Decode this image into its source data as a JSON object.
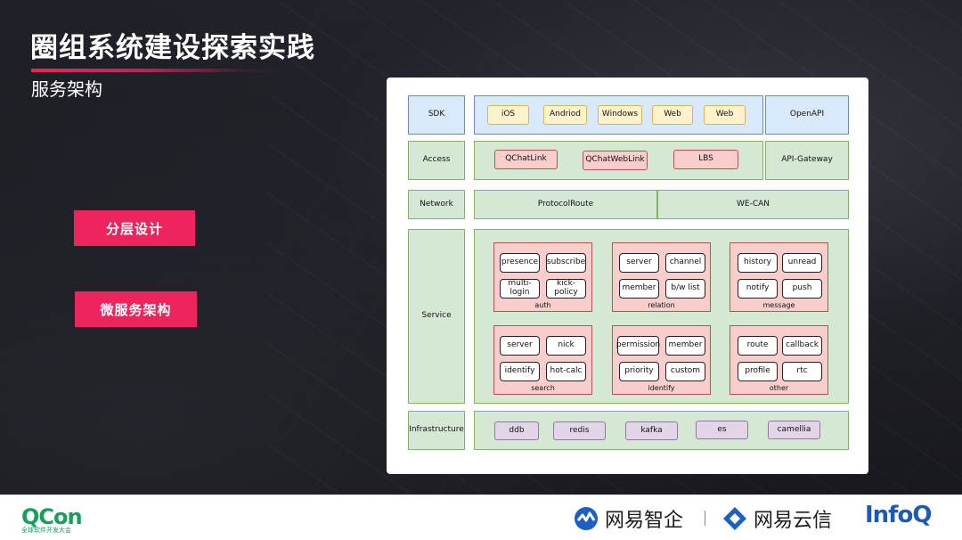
{
  "slide": {
    "title": "圈组系统建设探索实践",
    "subtitle": "服务架构",
    "pills": [
      "分层设计",
      "微服务架构"
    ]
  },
  "diagram": {
    "layers": [
      {
        "label": "SDK",
        "items": [
          "iOS",
          "Andriod",
          "Windows",
          "Web",
          "Web"
        ],
        "side": "OpenAPI"
      },
      {
        "label": "Access",
        "items": [
          "QChatLink",
          "QChatWebLink",
          "LBS"
        ],
        "side": "API-Gateway"
      },
      {
        "label": "Network",
        "items": [
          "ProtocolRoute",
          "WE-CAN"
        ]
      },
      {
        "label": "Service"
      },
      {
        "label": "Infrastructure",
        "items": [
          "ddb",
          "redis",
          "kafka",
          "es",
          "camellia"
        ]
      }
    ],
    "service_groups": [
      {
        "name": "auth",
        "items": [
          "presence",
          "subscribe",
          "multi-login",
          "kick-policy"
        ]
      },
      {
        "name": "relation",
        "items": [
          "server",
          "channel",
          "member",
          "b/w list"
        ]
      },
      {
        "name": "message",
        "items": [
          "history",
          "unread",
          "notify",
          "push"
        ]
      },
      {
        "name": "search",
        "items": [
          "server",
          "nick",
          "identify",
          "hot-calc"
        ]
      },
      {
        "name": "identify",
        "items": [
          "permission",
          "member",
          "priority",
          "custom"
        ]
      },
      {
        "name": "other",
        "items": [
          "route",
          "callback",
          "profile",
          "rtc"
        ]
      }
    ]
  },
  "footer": {
    "qcon": "QCon",
    "qcon_sub": "全球软件开发大会",
    "brand1": "网易智企",
    "brand2": "网易云信",
    "infoq": "InfoQ"
  },
  "colors": {
    "accent": "#f0245c",
    "qcon_green": "#16a05d",
    "infoq_blue": "#1f5ab1"
  }
}
